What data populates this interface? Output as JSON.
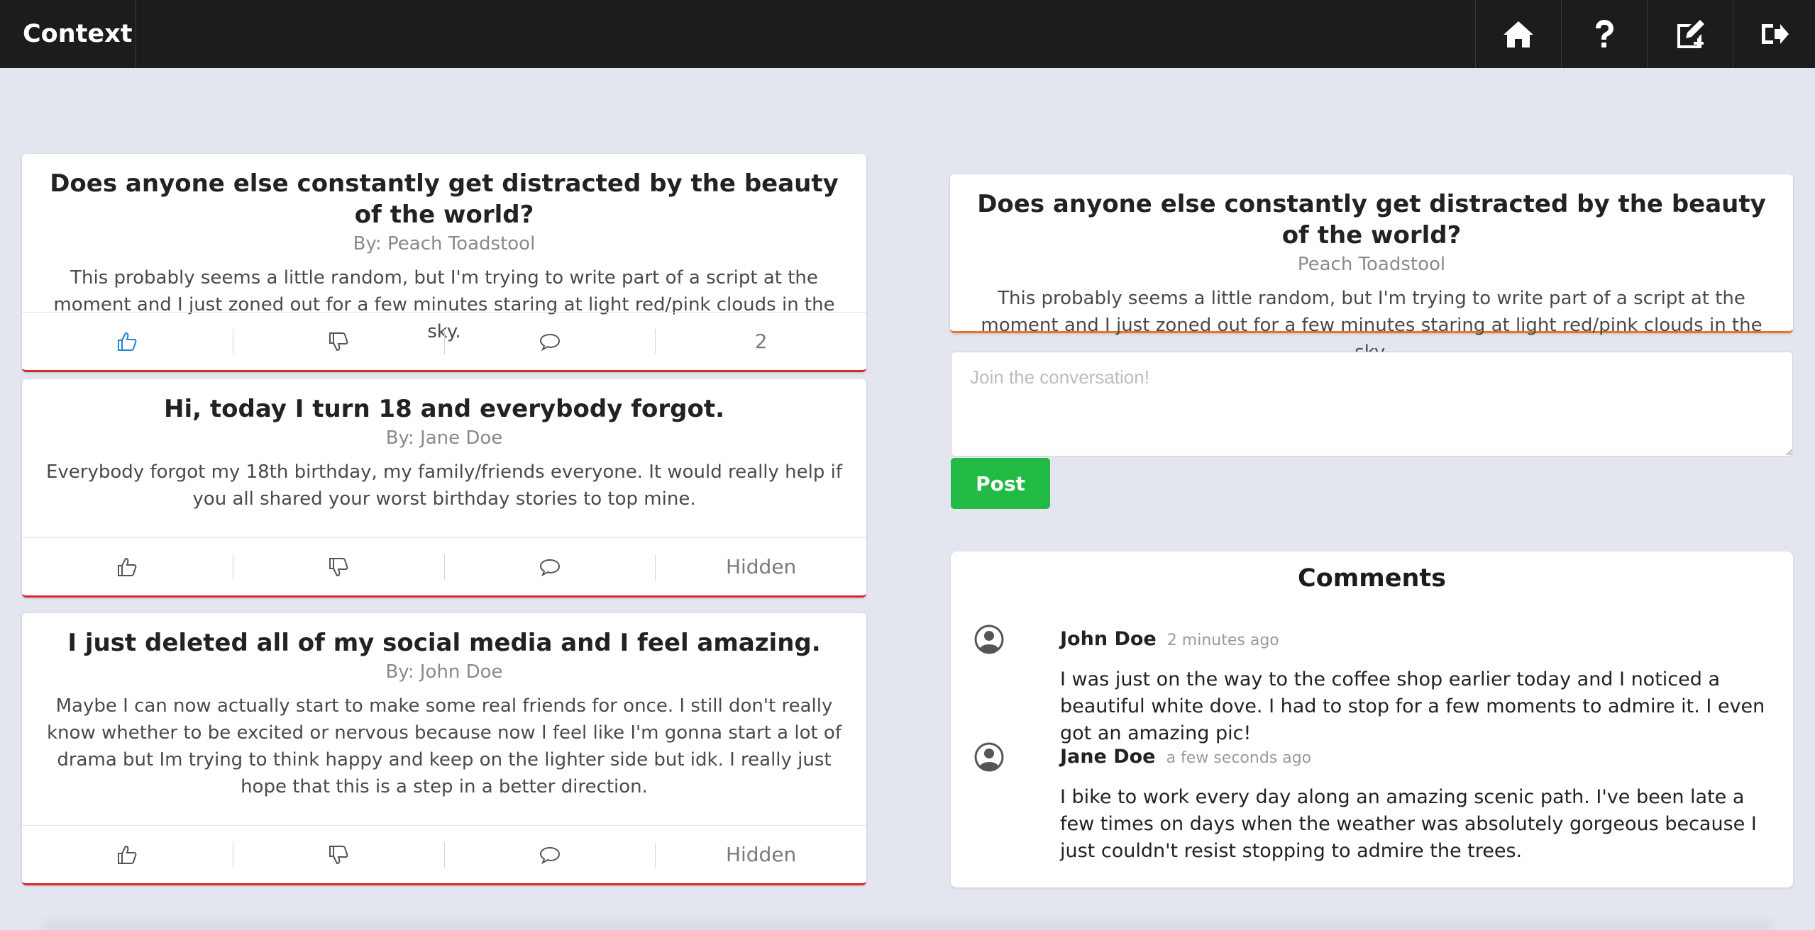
{
  "app": {
    "brand": "Context",
    "nav": [
      {
        "icon": "home-icon"
      },
      {
        "icon": "help-icon"
      },
      {
        "icon": "new-post-icon"
      },
      {
        "icon": "logout-icon"
      }
    ]
  },
  "feed": [
    {
      "title": "Does anyone else constantly get distracted by the beauty of the world?",
      "author": "By: Peach Toadstool",
      "body": "This probably seems a little random, but I'm trying to write part of a script at the moment and I just zoned out for a few minutes staring at light red/pink clouds in the sky.",
      "like_active": true,
      "status": "2"
    },
    {
      "title": "Hi, today I turn 18 and everybody forgot.",
      "author": "By: Jane Doe",
      "body": "Everybody forgot my 18th birthday, my family/friends everyone. It would really help if you all shared your worst birthday stories to top mine.",
      "like_active": false,
      "status": "Hidden"
    },
    {
      "title": "I just deleted all of my social media and I feel amazing.",
      "author": "By: John Doe",
      "body": "Maybe I can now actually start to make some real friends for once. I still don't really know whether to be excited or nervous because now I feel like I'm gonna start a lot of drama but Im trying to think happy and keep on the lighter side but idk. I really just hope that this is a step in a better direction.",
      "like_active": false,
      "status": "Hidden"
    }
  ],
  "detail": {
    "title": "Does anyone else constantly get distracted by the beauty of the world?",
    "author": "Peach Toadstool",
    "body": "This probably seems a little random, but I'm trying to write part of a script at the moment and I just zoned out for a few minutes staring at light red/pink clouds in the sky."
  },
  "reply": {
    "placeholder": "Join the conversation!",
    "value": "",
    "post_label": "Post"
  },
  "comments": {
    "heading": "Comments",
    "items": [
      {
        "name": "John Doe",
        "time": "2 minutes ago",
        "text": "I was just on the way to the coffee shop earlier today and I noticed a beautiful white dove. I had to stop for a few moments to admire it. I even got an amazing pic!"
      },
      {
        "name": "Jane Doe",
        "time": "a few seconds ago",
        "text": "I bike to work every day along an amazing scenic path. I've been late a few times on days when the weather was absolutely gorgeous because I just couldn't resist stopping to admire the trees."
      }
    ]
  },
  "colors": {
    "topbar": "#1b1c1d",
    "background": "#e3e6ef",
    "card_accent": "#db2828",
    "detail_accent": "#f2711c",
    "post_button": "#21ba45",
    "like_active": "#2185d0"
  }
}
